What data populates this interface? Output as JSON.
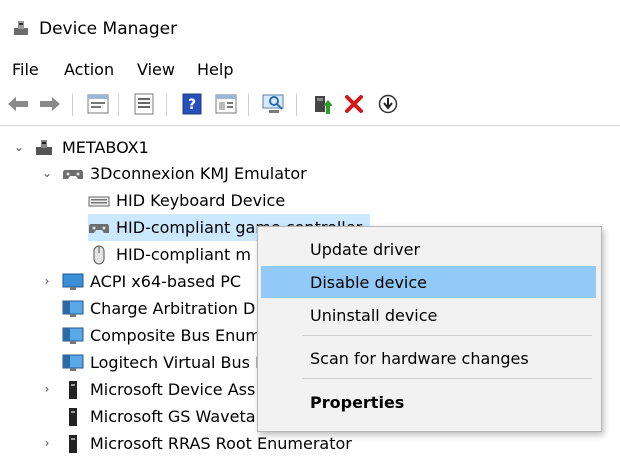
{
  "window": {
    "title": "Device Manager",
    "icon": "device-manager-icon"
  },
  "menu": [
    "File",
    "Action",
    "View",
    "Help"
  ],
  "toolbar": {
    "icons": [
      "back-arrow-icon",
      "forward-arrow-icon",
      "properties-icon",
      "list-view-icon",
      "help-icon",
      "show-hide-icon",
      "scan-hardware-icon",
      "update-driver-icon",
      "uninstall-icon",
      "download-icon"
    ],
    "accent_red": "#d11a1a",
    "accent_green": "#2e9b2e"
  },
  "tree": {
    "root": "METABOX1",
    "expanded_category": "3Dconnexion KMJ Emulator",
    "children": [
      "HID Keyboard Device",
      "HID-compliant game controller",
      "HID-compliant m"
    ],
    "categories": [
      "ACPI x64-based PC",
      "Charge Arbitration D",
      "Composite Bus Enum",
      "Logitech Virtual Bus E",
      "Microsoft Device Ass",
      "Microsoft GS Waveta",
      "Microsoft RRAS Root Enumerator"
    ],
    "selected_color": "#cce8ff"
  },
  "context_menu": {
    "items": [
      "Update driver",
      "Disable device",
      "Uninstall device",
      "Scan for hardware changes",
      "Properties"
    ],
    "highlighted": "Disable device",
    "highlight_color": "#91c9f7"
  }
}
